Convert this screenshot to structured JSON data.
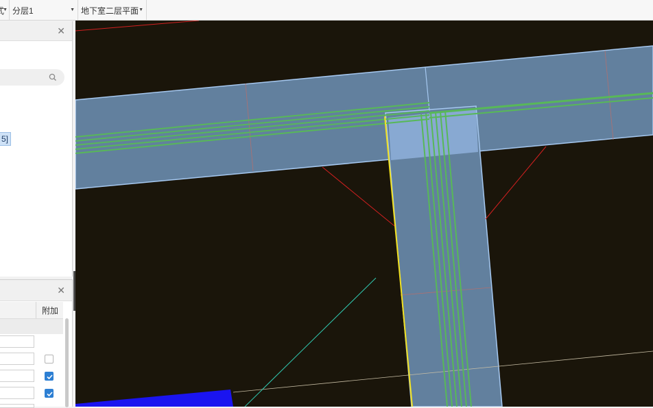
{
  "toolbar": {
    "dropdown_1_label": "式",
    "dropdown_2_label": "分层1",
    "dropdown_3_label": "地下室二层平面"
  },
  "left_panel_top": {
    "close_icon": "close-icon",
    "search_icon": "search-icon",
    "selected_tag": "5]"
  },
  "left_panel_bottom": {
    "close_icon": "close-icon",
    "column_header_attach": "附加",
    "checkboxes": [
      false,
      true,
      true
    ]
  },
  "canvas": {
    "background": "#1a150a",
    "beam_color": "#62809e",
    "beam_edge": "#a6c8f0",
    "rebar_color": "#58b858",
    "highlight_color": "#8fb0da"
  }
}
